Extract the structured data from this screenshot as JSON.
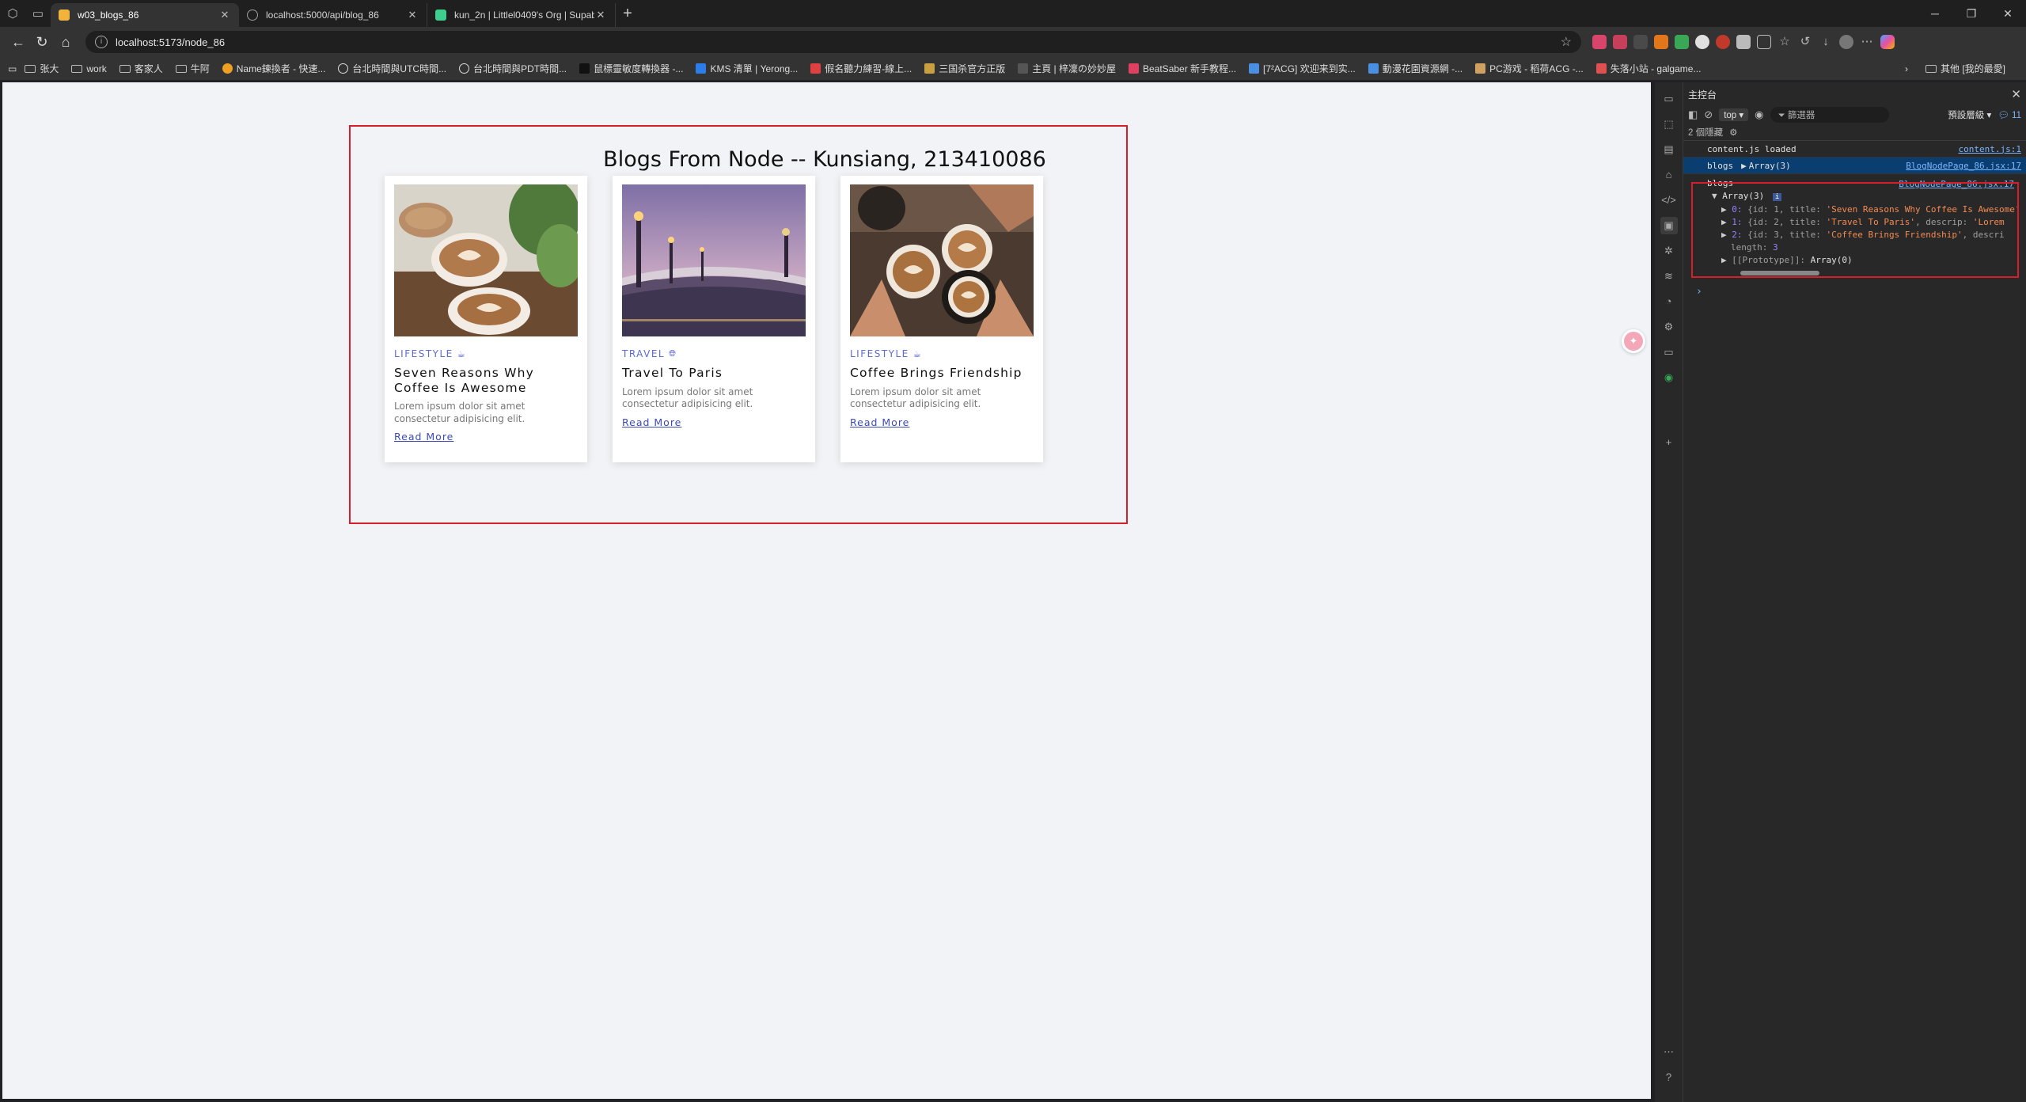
{
  "browser": {
    "tabs": [
      {
        "title": "w03_blogs_86",
        "active": true,
        "favicon_color": "#f2b33d"
      },
      {
        "title": "localhost:5000/api/blog_86",
        "active": false,
        "favicon_color": "#9aa0a6"
      },
      {
        "title": "kun_2n | Littlel0409's Org | Supab...",
        "active": false,
        "favicon_color": "#3ecf8e"
      }
    ],
    "url": "localhost:5173/node_86",
    "bookmarks": [
      {
        "label": "张大",
        "type": "folder"
      },
      {
        "label": "work",
        "type": "folder"
      },
      {
        "label": "客家人",
        "type": "folder"
      },
      {
        "label": "牛阿",
        "type": "folder"
      },
      {
        "label": "Name鍊換者 - 快速...",
        "type": "link",
        "color": "#f0a020"
      },
      {
        "label": "台北時間與UTC時間...",
        "type": "link",
        "color": "#ffffff"
      },
      {
        "label": "台北時間與PDT時間...",
        "type": "link",
        "color": "#ffffff"
      },
      {
        "label": "鼠標靈敏度轉換器 -...",
        "type": "link",
        "color": "#222222"
      },
      {
        "label": "KMS 清單 | Yerong...",
        "type": "link",
        "color": "#2b7de9"
      },
      {
        "label": "假名聽力練習-線上...",
        "type": "link",
        "color": "#e04040"
      },
      {
        "label": "三国杀官方正版",
        "type": "link",
        "color": "#c8a040"
      },
      {
        "label": "主頁 | 梓凜の妙妙屋",
        "type": "link",
        "color": "#333333"
      },
      {
        "label": "BeatSaber 新手教程...",
        "type": "link",
        "color": "#e04060"
      },
      {
        "label": "[7²ACG] 欢迎来到实...",
        "type": "link",
        "color": "#4a90e2"
      },
      {
        "label": "動漫花園資源網 -...",
        "type": "link",
        "color": "#4a90e2"
      },
      {
        "label": "PC游戏 - 稻荷ACG -...",
        "type": "link",
        "color": "#d0a060"
      },
      {
        "label": "失落小站 - galgame...",
        "type": "link",
        "color": "#e05050"
      }
    ],
    "bookmarks_other": "其他 [我的最愛]"
  },
  "page": {
    "title": "Blogs From Node -- Kunsiang, 213410086",
    "blogs": [
      {
        "category": "LIFESTYLE",
        "title": "Seven Reasons Why Coffee Is Awesome",
        "description": "Lorem ipsum dolor sit amet consectetur adipisicing elit.",
        "link": "Read More"
      },
      {
        "category": "TRAVEL",
        "title": "Travel To Paris",
        "description": "Lorem ipsum dolor sit amet consectetur adipisicing elit.",
        "link": "Read More"
      },
      {
        "category": "LIFESTYLE",
        "title": "Coffee Brings Friendship",
        "description": "Lorem ipsum dolor sit amet consectetur adipisicing elit.",
        "link": "Read More"
      }
    ]
  },
  "devtools": {
    "panel_title": "主控台",
    "context": "top",
    "filter_placeholder": "篩選器",
    "levels": "預設層級",
    "issue_count": "11",
    "hidden_count": "2 個隱藏",
    "logs": [
      {
        "text": "content.js loaded",
        "source": "content.js:1"
      },
      {
        "label": "blogs",
        "value": "Array(3)",
        "source": "BlogNodePage_86.jsx:17"
      }
    ],
    "expanded": {
      "label": "blogs",
      "source": "BlogNodePage_86.jsx:17",
      "array_head": "Array(3)",
      "items": [
        {
          "index": "0:",
          "prefix": "{id: 1, title: ",
          "title": "'Seven Reasons Why Coffee Is Awesome'"
        },
        {
          "index": "1:",
          "prefix": "{id: 2, title: ",
          "title": "'Travel To Paris'",
          "tail": ", descrip: ",
          "tail_str": "'Lorem"
        },
        {
          "index": "2:",
          "prefix": "{id: 3, title: ",
          "title": "'Coffee Brings Friendship'",
          "tail": ", descri"
        }
      ],
      "length_label": "length: ",
      "length_value": "3",
      "prototype_label": "[[Prototype]]: ",
      "prototype_value": "Array(0)"
    }
  }
}
